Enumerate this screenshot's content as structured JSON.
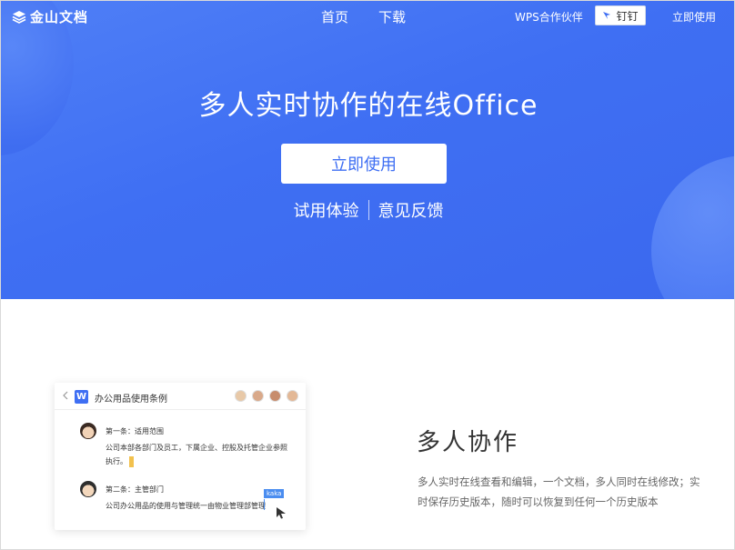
{
  "nav": {
    "logo_text": "金山文档",
    "home": "首页",
    "download": "下载",
    "partner": "WPS合作伙伴",
    "dingding": "钉钉",
    "use_now": "立即使用"
  },
  "hero": {
    "title": "多人实时协作的在线Office",
    "cta": "立即使用",
    "link_trial": "试用体验",
    "link_feedback": "意见反馈"
  },
  "doc_card": {
    "title": "办公用品使用条例",
    "w_icon": "W",
    "items": [
      {
        "title": "第一条：适用范围",
        "body": "公司本部各部门及员工，下属企业、控股及托管企业参照执行。"
      },
      {
        "title": "第二条：主管部门",
        "body": "公司办公用品的使用与管理统一由物业管理部管理"
      }
    ],
    "cursor_label": "kaka"
  },
  "feature": {
    "title": "多人协作",
    "desc": "多人实时在线查看和编辑，一个文档，多人同时在线修改；实时保存历史版本，随时可以恢复到任何一个历史版本"
  },
  "colors": {
    "brand": "#3f6ff3",
    "hero_bg": "#4a78f4"
  },
  "icons": [
    "logo-icon",
    "pin-icon",
    "back-arrow-icon",
    "w-doc-icon",
    "avatar",
    "pointer-icon"
  ]
}
